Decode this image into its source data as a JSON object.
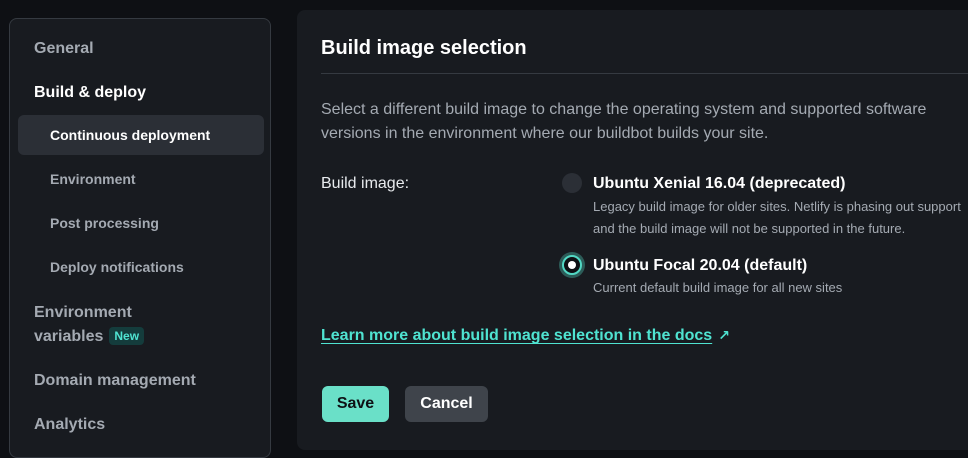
{
  "sidebar": {
    "items": [
      {
        "label": "General"
      },
      {
        "label": "Build & deploy"
      },
      {
        "label": "Environment variables",
        "label_line1": "Environment",
        "label_line2": "variables",
        "badge": "New"
      },
      {
        "label": "Domain management"
      },
      {
        "label": "Analytics"
      }
    ],
    "sub_items": [
      {
        "label": "Continuous deployment",
        "active": true
      },
      {
        "label": "Environment"
      },
      {
        "label": "Post processing"
      },
      {
        "label": "Deploy notifications"
      }
    ]
  },
  "main": {
    "title": "Build image selection",
    "description": "Select a different build image to change the operating system and supported software versions in the environment where our buildbot builds your site.",
    "field_label": "Build image:",
    "options": [
      {
        "title": "Ubuntu Xenial 16.04 (deprecated)",
        "description": "Legacy build image for older sites. Netlify is phasing out support and the build image will not be supported in the future.",
        "selected": false
      },
      {
        "title": "Ubuntu Focal 20.04 (default)",
        "description": "Current default build image for all new sites",
        "selected": true
      }
    ],
    "docs_link": "Learn more about build image selection in the docs",
    "save_label": "Save",
    "cancel_label": "Cancel"
  },
  "colors": {
    "accent": "#52d8c4",
    "link": "#4fe3d1",
    "save_button": "#6ae0c8",
    "background": "#0e1014",
    "panel": "#181b20"
  }
}
